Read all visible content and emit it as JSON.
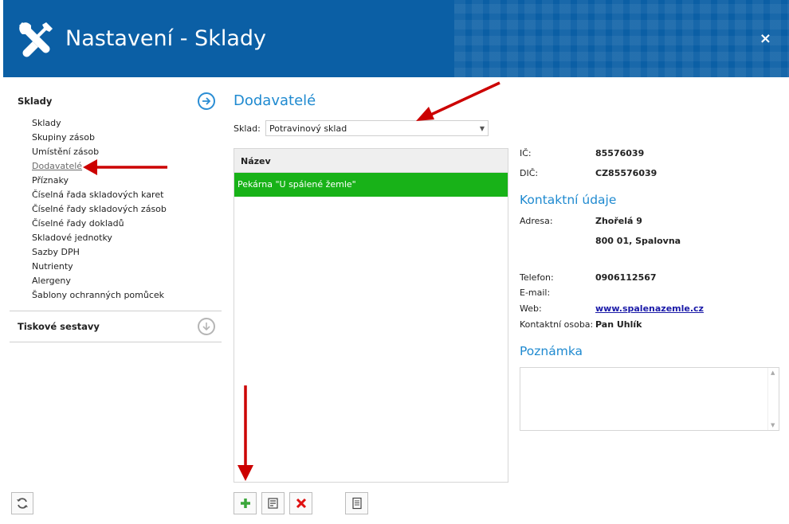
{
  "window": {
    "title": "Nastavení - Sklady",
    "close_label": "×"
  },
  "sidebar": {
    "section1": {
      "label": "Sklady",
      "items": [
        {
          "label": "Sklady"
        },
        {
          "label": "Skupiny zásob"
        },
        {
          "label": "Umístění zásob"
        },
        {
          "label": "Dodavatelé",
          "active": true
        },
        {
          "label": "Příznaky"
        },
        {
          "label": "Číselná řada skladových karet"
        },
        {
          "label": "Číselné řady skladových zásob"
        },
        {
          "label": "Číselné řady dokladů"
        },
        {
          "label": "Skladové jednotky"
        },
        {
          "label": "Sazby DPH"
        },
        {
          "label": "Nutrienty"
        },
        {
          "label": "Alergeny"
        },
        {
          "label": "Šablony ochranných pomůcek"
        }
      ]
    },
    "section2": {
      "label": "Tiskové sestavy"
    }
  },
  "main": {
    "title": "Dodavatelé",
    "sklad_label": "Sklad:",
    "sklad_value": "Potravinový sklad",
    "grid": {
      "column": "Název",
      "rows": [
        {
          "name": "Pekárna \"U spálené žemle\""
        }
      ]
    }
  },
  "detail": {
    "ic_label": "IČ:",
    "ic_value": "85576039",
    "dic_label": "DIČ:",
    "dic_value": "CZ85576039",
    "contact_title": "Kontaktní údaje",
    "address_label": "Adresa:",
    "address_line1": "Zhořelá 9",
    "address_line2": "800 01, Spalovna",
    "phone_label": "Telefon:",
    "phone_value": "0906112567",
    "email_label": "E-mail:",
    "email_value": "",
    "web_label": "Web:",
    "web_value": "www.spalenazemle.cz",
    "person_label": "Kontaktní osoba:",
    "person_value": "Pan Uhlík",
    "note_title": "Poznámka"
  },
  "colors": {
    "header": "#0b5fa5",
    "accent": "#1f8ad0",
    "selected_row": "#18b218",
    "annotation": "#cc0000"
  },
  "icons": {
    "header": "wrench-screwdriver-icon",
    "section1": "arrow-right-circle-icon",
    "section2": "arrow-down-circle-icon",
    "refresh": "refresh-icon",
    "add": "plus-icon",
    "edit": "edit-icon",
    "delete": "delete-icon",
    "report": "document-icon"
  }
}
